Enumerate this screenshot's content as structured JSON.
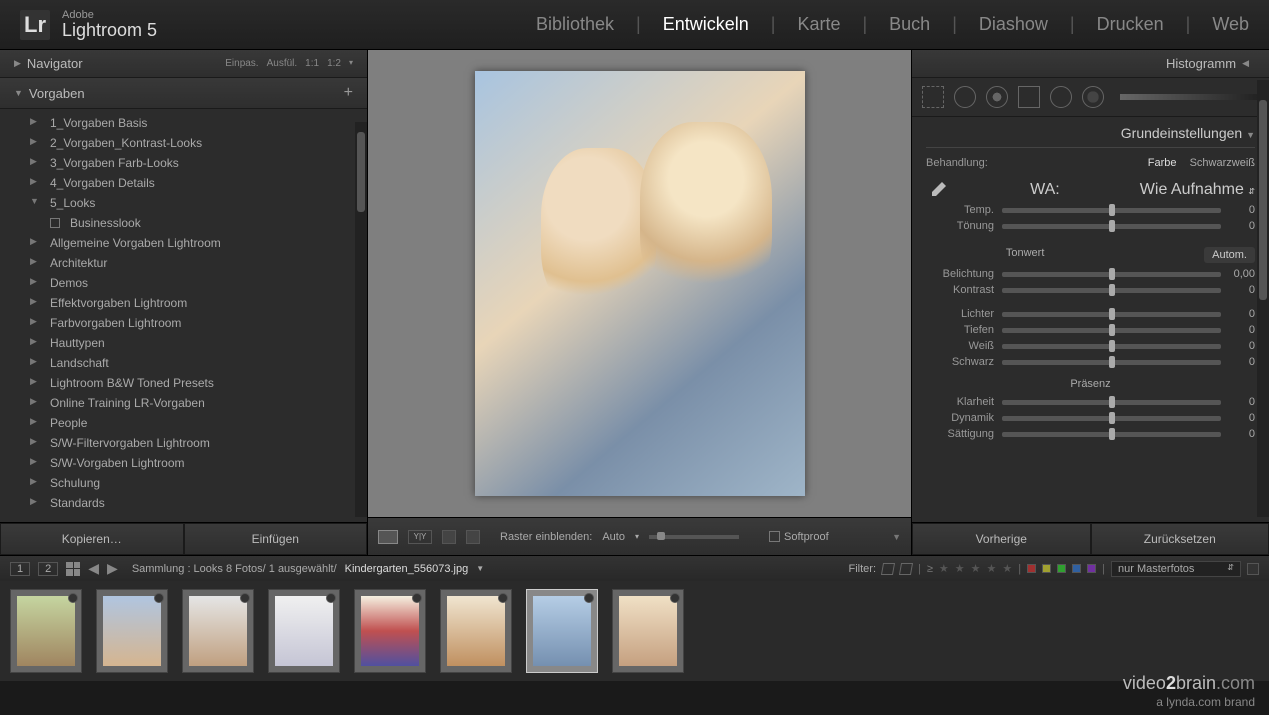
{
  "app": {
    "brand": "Adobe",
    "product": "Lightroom 5"
  },
  "modules": [
    "Bibliothek",
    "Entwickeln",
    "Karte",
    "Buch",
    "Diashow",
    "Drucken",
    "Web"
  ],
  "active_module": "Entwickeln",
  "left": {
    "navigator": {
      "title": "Navigator",
      "opts": [
        "Einpas.",
        "Ausfül.",
        "1:1",
        "1:2"
      ]
    },
    "presets": {
      "title": "Vorgaben",
      "items": [
        {
          "label": "1_Vorgaben Basis"
        },
        {
          "label": "2_Vorgaben_Kontrast-Looks"
        },
        {
          "label": "3_Vorgaben Farb-Looks"
        },
        {
          "label": "4_Vorgaben Details"
        },
        {
          "label": "5_Looks",
          "expanded": true,
          "children": [
            {
              "label": "Businesslook"
            }
          ]
        },
        {
          "label": "Allgemeine Vorgaben Lightroom"
        },
        {
          "label": "Architektur"
        },
        {
          "label": "Demos"
        },
        {
          "label": "Effektvorgaben Lightroom"
        },
        {
          "label": "Farbvorgaben Lightroom"
        },
        {
          "label": "Hauttypen"
        },
        {
          "label": "Landschaft"
        },
        {
          "label": "Lightroom B&W Toned Presets"
        },
        {
          "label": "Online Training LR-Vorgaben"
        },
        {
          "label": "People"
        },
        {
          "label": "S/W-Filtervorgaben Lightroom"
        },
        {
          "label": "S/W-Vorgaben Lightroom"
        },
        {
          "label": "Schulung"
        },
        {
          "label": "Standards"
        }
      ]
    },
    "buttons": {
      "copy": "Kopieren…",
      "paste": "Einfügen"
    }
  },
  "center": {
    "grid_label": "Raster einblenden:",
    "grid_value": "Auto",
    "softproof": "Softproof"
  },
  "right": {
    "histogram": "Histogramm",
    "basic": {
      "title": "Grundeinstellungen",
      "treatment_label": "Behandlung:",
      "color": "Farbe",
      "bw": "Schwarzweiß",
      "wb_label": "WA:",
      "wb_value": "Wie Aufnahme",
      "tone_title": "Tonwert",
      "auto": "Autom.",
      "presence_title": "Präsenz",
      "sliders": {
        "temp": {
          "label": "Temp.",
          "value": "0"
        },
        "tint": {
          "label": "Tönung",
          "value": "0"
        },
        "exposure": {
          "label": "Belichtung",
          "value": "0,00"
        },
        "contrast": {
          "label": "Kontrast",
          "value": "0"
        },
        "highlights": {
          "label": "Lichter",
          "value": "0"
        },
        "shadows": {
          "label": "Tiefen",
          "value": "0"
        },
        "whites": {
          "label": "Weiß",
          "value": "0"
        },
        "blacks": {
          "label": "Schwarz",
          "value": "0"
        },
        "clarity": {
          "label": "Klarheit",
          "value": "0"
        },
        "vibrance": {
          "label": "Dynamik",
          "value": "0"
        },
        "saturation": {
          "label": "Sättigung",
          "value": "0"
        }
      }
    },
    "buttons": {
      "prev": "Vorherige",
      "reset": "Zurücksetzen"
    }
  },
  "filmstrip": {
    "pages": [
      "1",
      "2"
    ],
    "collection": "Sammlung : Looks   8 Fotos/  1 ausgewählt/",
    "filename": "Kindergarten_556073.jpg",
    "filter_label": "Filter:",
    "filter_dropdown": "nur Masterfotos",
    "thumb_count": 8,
    "selected_index": 6
  },
  "watermark": {
    "line1a": "video",
    "line1b": "2",
    "line1c": "brain",
    "line1d": ".com",
    "line2": "a lynda.com brand"
  }
}
